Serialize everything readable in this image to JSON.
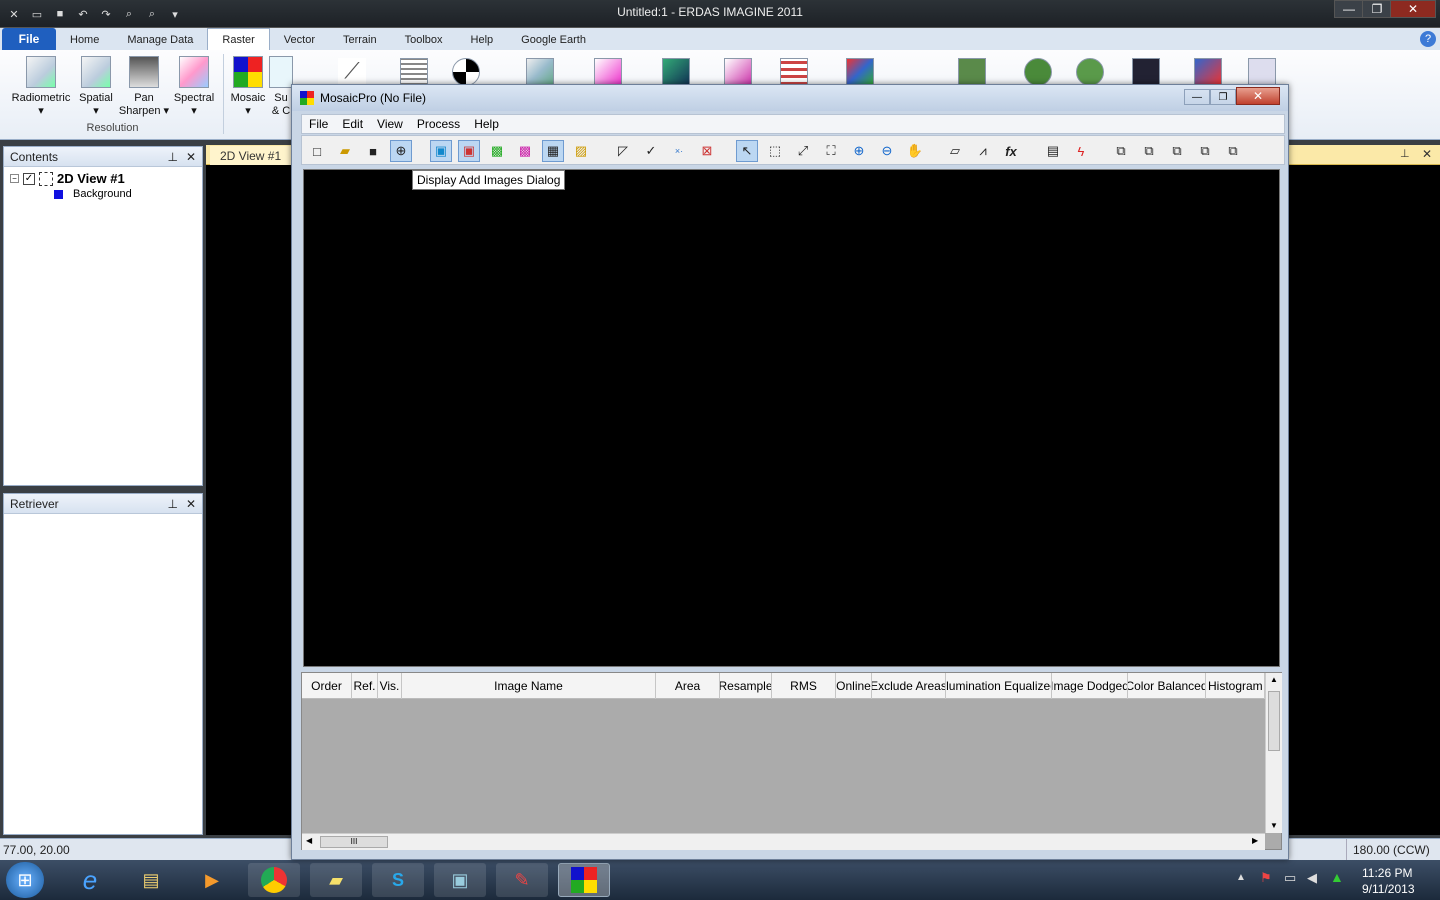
{
  "app": {
    "title": "Untitled:1 - ERDAS IMAGINE 2011"
  },
  "ribbon": {
    "file_tab": "File",
    "tabs": [
      "Home",
      "Manage Data",
      "Raster",
      "Vector",
      "Terrain",
      "Toolbox",
      "Help",
      "Google Earth"
    ],
    "active_tab": "Raster",
    "buttons": [
      {
        "label": "Radiometric",
        "sub": "▾"
      },
      {
        "label": "Spatial",
        "sub": "▾"
      },
      {
        "label": "Pan",
        "sub": "Sharpen ▾"
      },
      {
        "label": "Spectral",
        "sub": "▾"
      },
      {
        "label": "Mosaic",
        "sub": "▾"
      },
      {
        "label": "Su",
        "sub": "& C"
      }
    ],
    "group_label": "Resolution"
  },
  "contents_pane": {
    "title": "Contents",
    "view_name": "2D View #1",
    "layer": "Background",
    "layer_color": "#1010e0"
  },
  "retriever_pane": {
    "title": "Retriever"
  },
  "view_tab": "2D View #1",
  "mosaic": {
    "title": "MosaicPro (No File)",
    "menu": [
      "File",
      "Edit",
      "View",
      "Process",
      "Help"
    ],
    "tooltip": "Display Add Images Dialog",
    "columns": [
      "Order",
      "Ref.",
      "Vis.",
      "Image Name",
      "Area",
      "Resample",
      "RMS",
      "Online",
      "Exclude Areas",
      "Illumination Equalized",
      "Image Dodged",
      "Color Balanced",
      "Histogram M"
    ],
    "scroll_thumb": "III"
  },
  "statusbar": {
    "coords": "77.00, 20.00",
    "rotation": "180.00 (CCW)"
  },
  "taskbar": {
    "time": "11:26 PM",
    "date": "9/11/2013"
  },
  "colors": {
    "file_tab": "#1f5fbf",
    "view_tab_bar": "#fbe9a8"
  }
}
